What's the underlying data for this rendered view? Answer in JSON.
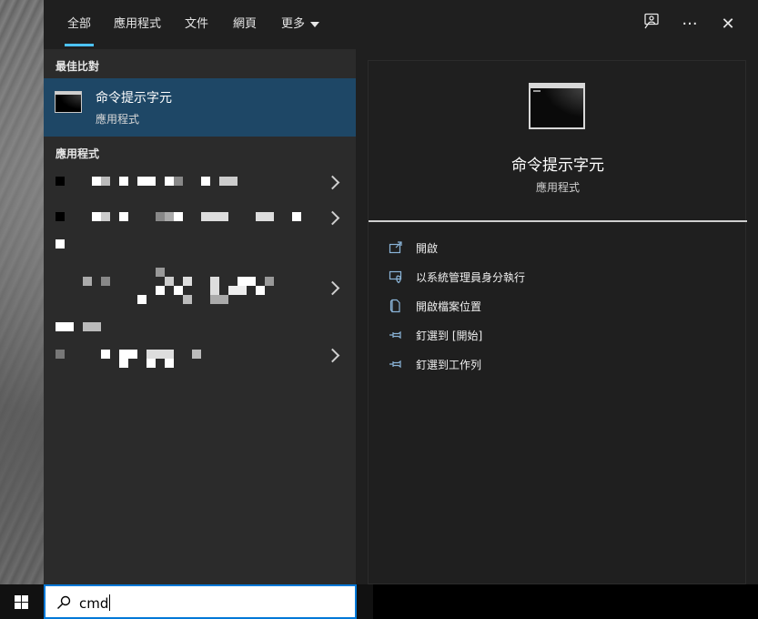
{
  "tabs": [
    {
      "label": "全部",
      "active": true
    },
    {
      "label": "應用程式",
      "active": false
    },
    {
      "label": "文件",
      "active": false
    },
    {
      "label": "網頁",
      "active": false
    },
    {
      "label": "更多",
      "active": false
    }
  ],
  "icons": {
    "feedback": "feedback-icon",
    "more": "more-options-icon",
    "close": "close-icon"
  },
  "more_glyph": "···",
  "close_glyph": "✕",
  "best_match": {
    "header": "最佳比對",
    "title": "命令提示字元",
    "subtitle": "應用程式"
  },
  "apps_header": "應用程式",
  "detail": {
    "title": "命令提示字元",
    "subtitle": "應用程式",
    "actions": [
      {
        "label": "開啟",
        "icon": "open-icon"
      },
      {
        "label": "以系統管理員身分執行",
        "icon": "shield-admin-icon"
      },
      {
        "label": "開啟檔案位置",
        "icon": "file-location-icon"
      },
      {
        "label": "釘選到 [開始]",
        "icon": "pin-icon"
      },
      {
        "label": "釘選到工作列",
        "icon": "pin-icon"
      }
    ]
  },
  "search": {
    "value": "cmd"
  },
  "colors": {
    "accent": "#4cc2ff",
    "selected": "#1e4766",
    "panel": "#1f1f1f",
    "list": "#2b2b2b"
  }
}
